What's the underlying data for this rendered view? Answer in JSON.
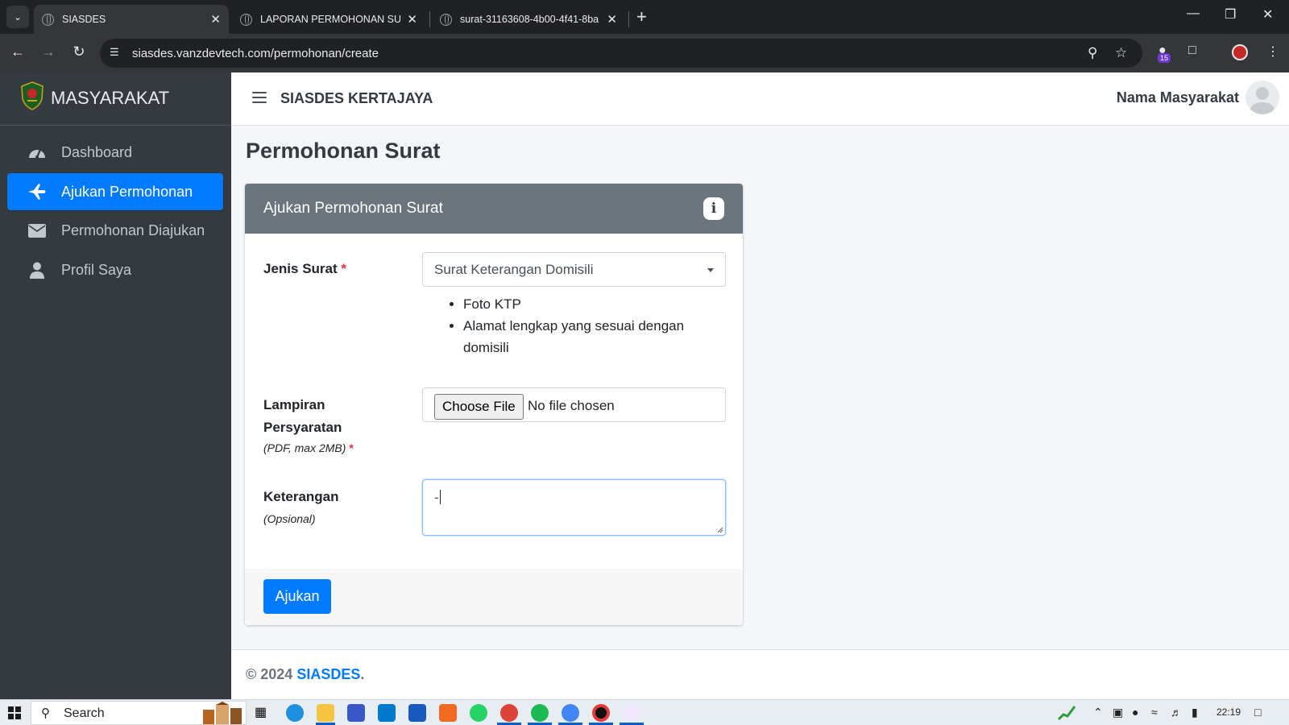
{
  "browser": {
    "tabs": [
      {
        "title": "SIASDES",
        "active": true
      },
      {
        "title": "LAPORAN PERMOHONAN SUR",
        "active": false
      },
      {
        "title": "surat-31163608-4b00-4f41-8ba",
        "active": false
      }
    ],
    "url": "siasdes.vanzdevtech.com/permohonan/create",
    "extension_badge": "15"
  },
  "sidebar": {
    "brand": "MASYARAKAT",
    "items": [
      {
        "label": "Dashboard",
        "icon": "tachometer-icon",
        "active": false
      },
      {
        "label": "Ajukan Permohonan",
        "icon": "paper-plane-icon",
        "active": true
      },
      {
        "label": "Permohonan Diajukan",
        "icon": "envelope-icon",
        "active": false
      },
      {
        "label": "Profil Saya",
        "icon": "user-icon",
        "active": false
      }
    ]
  },
  "header": {
    "site_title": "SIASDES KERTAJAYA",
    "user_name": "Nama Masyarakat"
  },
  "page": {
    "title": "Permohonan Surat"
  },
  "form": {
    "card_title": "Ajukan Permohonan Surat",
    "jenis_surat": {
      "label": "Jenis Surat",
      "required_mark": "*",
      "value": "Surat Keterangan Domisili",
      "requirements": [
        "Foto KTP",
        "Alamat lengkap yang sesuai dengan domisili"
      ]
    },
    "lampiran": {
      "label_line1": "Lampiran",
      "label_line2": "Persyaratan",
      "hint": "(PDF, max 2MB)",
      "required_mark": "*",
      "button_label": "Choose File",
      "status": "No file chosen"
    },
    "keterangan": {
      "label": "Keterangan",
      "hint": "(Opsional)",
      "value": "-"
    },
    "submit_label": "Ajukan"
  },
  "footer": {
    "copyright": "© 2024",
    "brand_link": "SIASDES",
    "suffix": "."
  },
  "taskbar": {
    "search_label": "Search",
    "time": "22:19"
  },
  "colors": {
    "sidebar_bg": "#343a40",
    "primary": "#007bff",
    "card_header": "#6c757d",
    "required": "#dc3545"
  }
}
